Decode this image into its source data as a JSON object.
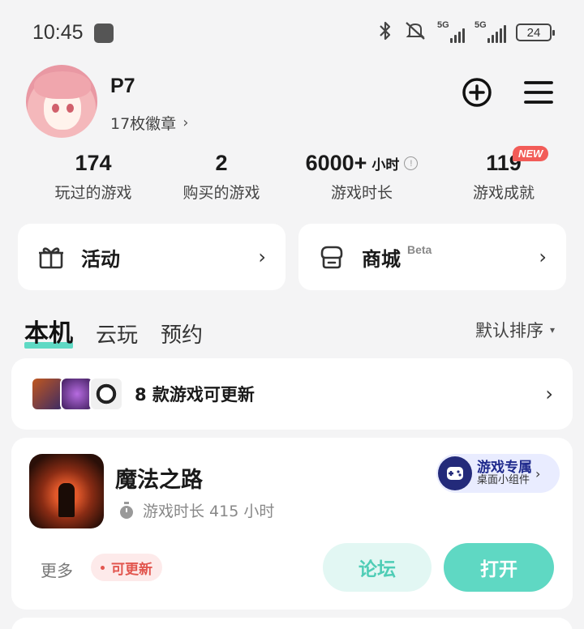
{
  "status_bar": {
    "time": "10:45",
    "network1": "5G",
    "network2": "5G",
    "battery": "24",
    "icons": [
      "bluetooth-icon",
      "mute-icon",
      "signal-icon",
      "battery-icon"
    ]
  },
  "profile": {
    "username": "P7",
    "badges_text": "17枚徽章",
    "badges_chevron": "›"
  },
  "stats": [
    {
      "value": "174",
      "label": "玩过的游戏"
    },
    {
      "value": "2",
      "label": "购买的游戏"
    },
    {
      "value": "6000+",
      "unit": "小时",
      "label": "游戏时长"
    },
    {
      "value": "119",
      "label": "游戏成就",
      "badge": "NEW"
    }
  ],
  "quick_links": {
    "activity": {
      "label": "活动",
      "chevron": "›"
    },
    "store": {
      "label": "商城",
      "tag": "Beta",
      "chevron": "›"
    }
  },
  "tabs": {
    "items": [
      "本机",
      "云玩",
      "预约"
    ],
    "active": 0,
    "sort_label": "默认排序",
    "sort_caret": "▾"
  },
  "updates": {
    "text": "8 款游戏可更新",
    "chevron": "›"
  },
  "game": {
    "name": "魔法之路",
    "playtime": "游戏时长 415 小时",
    "widget_title": "游戏专属",
    "widget_subtitle": "桌面小组件",
    "widget_chevron": "›",
    "more_label": "更多",
    "update_tag": "可更新",
    "forum_label": "论坛",
    "open_label": "打开"
  },
  "colors": {
    "accent": "#5fd8c3",
    "accent_light": "#e2f7f3",
    "badge_red": "#f25c58",
    "widget_blue": "#232a7a"
  }
}
